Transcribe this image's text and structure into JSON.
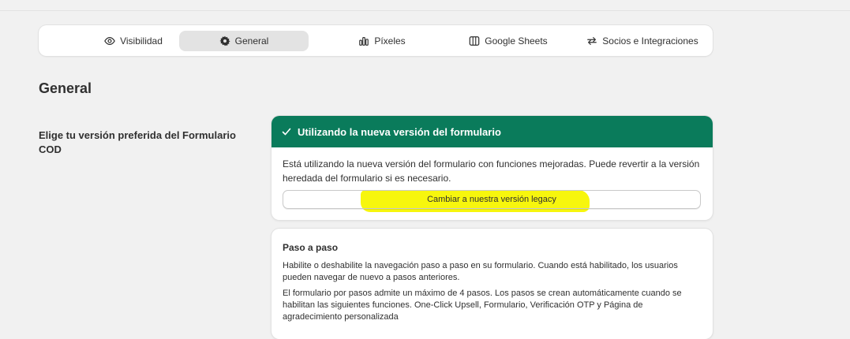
{
  "tabs": [
    {
      "label": "Visibilidad",
      "icon": "eye-icon"
    },
    {
      "label": "General",
      "icon": "gear-icon",
      "active": true
    },
    {
      "label": "Píxeles",
      "icon": "bar-chart-icon"
    },
    {
      "label": "Google Sheets",
      "icon": "columns-icon"
    },
    {
      "label": "Socios e Integraciones",
      "icon": "swap-arrows-icon"
    }
  ],
  "page": {
    "section_title": "General",
    "left_label": "Elige tu versión preferida del Formulario COD"
  },
  "version_card": {
    "banner_text": "Utilizando la nueva versión del formulario",
    "banner_color": "#0a7b5b",
    "description": "Está utilizando la nueva versión del formulario con funciones mejoradas. Puede revertir a la versión heredada del formulario si es necesario.",
    "legacy_button": "Cambiar a nuestra versión legacy",
    "highlight_color": "#f7f500"
  },
  "step_card": {
    "title": "Paso a paso",
    "paragraph1": "Habilite o deshabilite la navegación paso a paso en su formulario. Cuando está habilitado, los usuarios pueden navegar de nuevo a pasos anteriores.",
    "paragraph2": "El formulario por pasos admite un máximo de 4 pasos. Los pasos se crean automáticamente cuando se habilitan las siguientes funciones. One-Click Upsell, Formulario, Verificación OTP y Página de agradecimiento personalizada"
  }
}
